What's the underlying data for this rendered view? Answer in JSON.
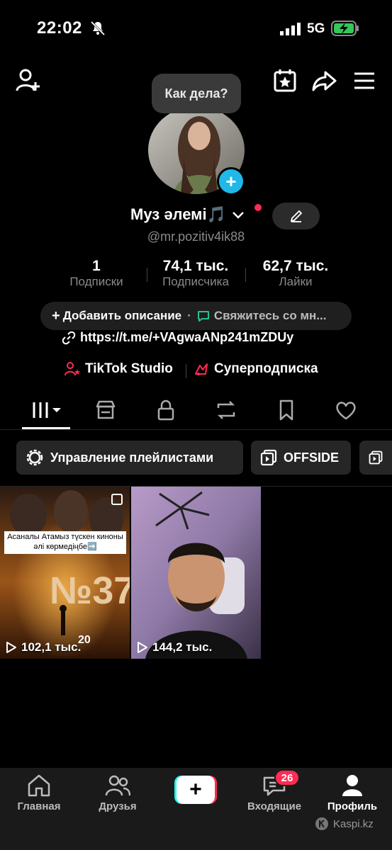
{
  "status_bar": {
    "time": "22:02",
    "network": "5G",
    "icons": [
      "silent-bell-icon",
      "signal-icon",
      "battery-charging-icon"
    ]
  },
  "profile": {
    "bubble_text": "Как дела?",
    "display_name": "Муз әлемі🎵",
    "handle": "@mr.pozitiv4ik88",
    "stats": [
      {
        "value": "1",
        "label": "Подписки"
      },
      {
        "value": "74,1 тыс.",
        "label": "Подписчика"
      },
      {
        "value": "62,7 тыс.",
        "label": "Лайки"
      }
    ],
    "add_description": "Добавить описание",
    "contact": "Свяжитесь со мн...",
    "link": "https://t.me/+VAgwaANp241mZDUy",
    "studio": "TikTok Studio",
    "subscription": "Суперподписка"
  },
  "tabs": [
    "videos-grid",
    "shop",
    "private",
    "reposts",
    "favorites",
    "liked"
  ],
  "playlists": [
    {
      "label": "Управление плейлистами"
    },
    {
      "label": "OFFSIDE"
    },
    {
      "label": ""
    }
  ],
  "videos": [
    {
      "views": "102,1 тыс.",
      "caption": "Асаналы Атамыз түскен киноны әлі көрмедіңбе➡️",
      "poster_title": "№37",
      "poster_small": "20"
    },
    {
      "views": "144,2 тыс."
    }
  ],
  "bottom_nav": [
    {
      "label": "Главная",
      "icon": "home-icon"
    },
    {
      "label": "Друзья",
      "icon": "friends-icon"
    },
    {
      "label": "",
      "icon": "create-plus-icon"
    },
    {
      "label": "Входящие",
      "icon": "inbox-icon",
      "badge": "26"
    },
    {
      "label": "Профиль",
      "icon": "profile-icon"
    }
  ],
  "watermark": "Kaspi.kz",
  "colors": {
    "accent_red": "#fe2c55",
    "accent_cyan": "#20b8e8",
    "background": "#000000"
  }
}
